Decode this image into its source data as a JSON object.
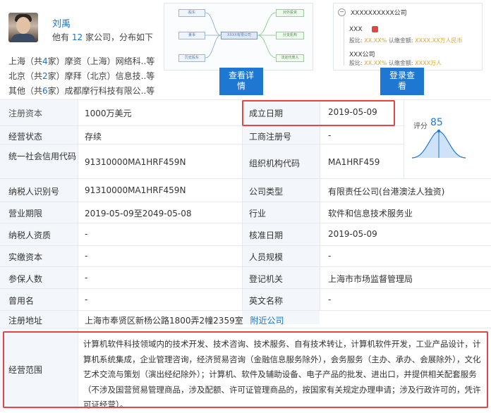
{
  "person": {
    "name": "刘禹",
    "desc_prefix": "他有",
    "company_count": "12",
    "desc_suffix": "家公司，分布如下"
  },
  "company_rows": [
    {
      "city": "上海（共",
      "count": "4",
      "rest": "家）摩资（上海）网络科..等"
    },
    {
      "city": "北京（共",
      "count": "2",
      "rest": "家）摩拜（北京）信息技..等"
    },
    {
      "city": "其他（共",
      "count": "6",
      "rest": "家）成都摩行科技有限公..等"
    }
  ],
  "structure_chart": {
    "boxes": [
      "股东",
      "董事",
      "历史股东",
      "XXXX有限公司",
      "对外投资",
      "分支机构",
      "法定代表人"
    ],
    "button": "查看详\n情"
  },
  "relation_panel": {
    "company": "XXXXXXXXXX公司",
    "items": [
      {
        "name": "XXX",
        "detail_label": "股比:",
        "detail_pct": "XX.XX%",
        "detail_sub": "认缴金额:",
        "detail_amt": "XXXX.XX万人民币"
      },
      {
        "name": "XXX公司",
        "detail_label": "股比:",
        "detail_pct": "XX.XX%",
        "detail_sub": "认缴金额:",
        "detail_amt": "XXXX万人"
      }
    ],
    "button": "登录查\n看"
  },
  "score": {
    "label": "评分",
    "value": "85"
  },
  "table": {
    "registered_capital_label": "注册资本",
    "registered_capital": "1000万美元",
    "established_label": "成立日期",
    "established": "2019-05-09",
    "status_label": "经营状态",
    "status": "存续",
    "biz_reg_no_label": "工商注册号",
    "biz_reg_no": "-",
    "credit_code_label": "统一社会信用代码",
    "credit_code": "91310000MA1HRF459N",
    "org_code_label": "组织机构代码",
    "org_code": "MA1HRF459",
    "taxpayer_id_label": "纳税人识别号",
    "taxpayer_id": "91310000MA1HRF459N",
    "company_type_label": "公司类型",
    "company_type": "有限责任公司(台港澳法人独资)",
    "term_label": "营业期限",
    "term": "2019-05-09至2049-05-08",
    "industry_label": "行业",
    "industry": "软件和信息技术服务业",
    "taxpayer_qual_label": "纳税人资质",
    "taxpayer_qual": "-",
    "approval_date_label": "核准日期",
    "approval_date": "2019-05-09",
    "paid_capital_label": "实缴资本",
    "paid_capital": "-",
    "staff_size_label": "人员规模",
    "staff_size": "-",
    "insured_label": "参保人数",
    "insured": "-",
    "reg_authority_label": "登记机关",
    "reg_authority": "上海市市场监督管理局",
    "former_name_label": "曾用名",
    "former_name": "-",
    "english_name_label": "英文名称",
    "english_name": "-",
    "address_label": "注册地址",
    "address": "上海市奉贤区新杨公路1800弄2幢2359室",
    "nearby_link": "附近公司",
    "scope_label": "经营范围",
    "scope": "计算机软件科技领域内的技术开发、技术咨询、技术服务、自有技术转让，计算机软件开发，工业产品设计，计算机系统集成，企业管理咨询，经济贸易咨询（金融信息服务除外），会务服务（主办、承办、会展除外），文化艺术交流与策划（演出经纪除外）；计算机、软件及辅助设备、电子产品的批发、进出口，并提供相关配套服务（不涉及国营贸易管理商品，涉及配额、许可证管理商品的，按国家有关规定办理申请；涉及行政许可的，凭许可证经营）。"
  },
  "colors": {
    "accent": "#1e78d2",
    "highlight": "#e24645",
    "label_bg": "#f3f6fa"
  }
}
